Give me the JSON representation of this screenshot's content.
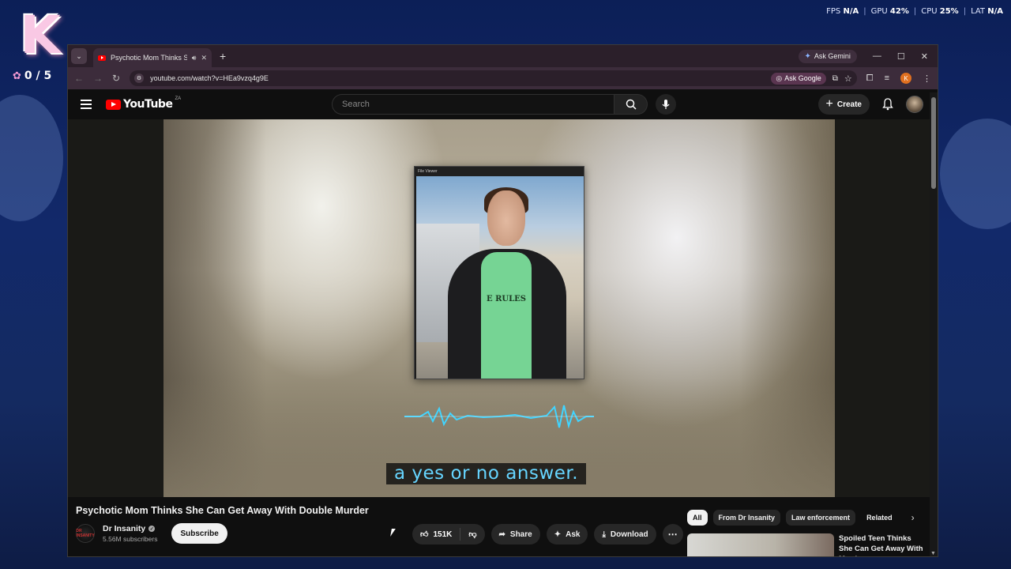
{
  "overlay": {
    "logo_letter": "K",
    "counter": "0 / 5",
    "stats": [
      {
        "label": "FPS",
        "value": "N/A"
      },
      {
        "label": "GPU",
        "value": "42%"
      },
      {
        "label": "CPU",
        "value": "25%"
      },
      {
        "label": "LAT",
        "value": "N/A"
      }
    ]
  },
  "browser": {
    "tab_title": "Psychotic Mom Thinks She",
    "new_tab": "+",
    "ask_gemini": "Ask Gemini",
    "url": "youtube.com/watch?v=HEa9vzq4g9E",
    "ask_google": "Ask Google",
    "profile_initial": "K"
  },
  "youtube": {
    "logo_word": "YouTube",
    "region": "ZA",
    "search_placeholder": "Search",
    "create_label": "Create"
  },
  "player": {
    "file_viewer_title": "File Viewer",
    "shirt_text": "E RULES",
    "caption": "a yes or no answer."
  },
  "video": {
    "title": "Psychotic Mom Thinks She Can Get Away With Double Murder",
    "channel_name": "Dr Insanity",
    "channel_avatar_text": "DR INSANITY",
    "subscribers": "5.56M subscribers",
    "subscribe_label": "Subscribe",
    "likes": "151K",
    "share_label": "Share",
    "ask_label": "Ask",
    "download_label": "Download"
  },
  "sidebar": {
    "chips": [
      "All",
      "From Dr Insanity",
      "Law enforcement",
      "Related"
    ],
    "recommendation_title": "Spoiled Teen Thinks She Can Get Away With Murder"
  },
  "colors": {
    "caption": "#66d5ff",
    "youtube_red": "#ff0000",
    "tab_bar": "#2b1f2a"
  }
}
